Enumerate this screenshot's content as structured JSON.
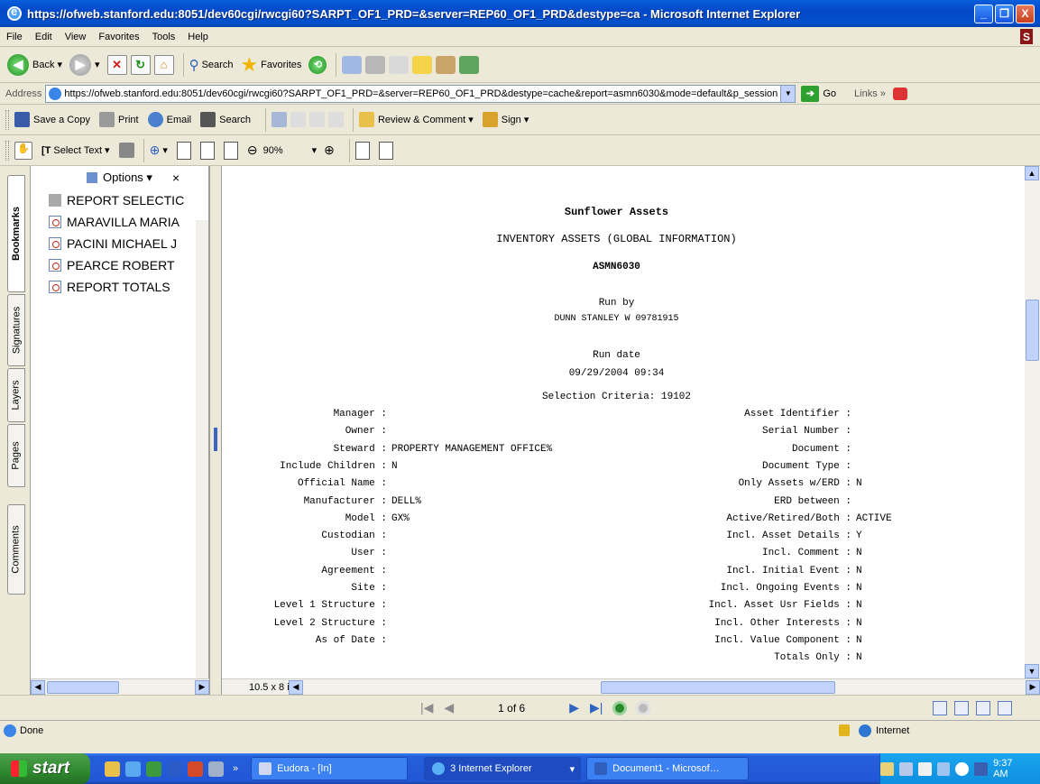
{
  "window": {
    "title": "https://ofweb.stanford.edu:8051/dev60cgi/rwcgi60?SARPT_OF1_PRD=&server=REP60_OF1_PRD&destype=ca - Microsoft Internet Explorer",
    "minimize": "_",
    "maximize": "❐",
    "close": "X"
  },
  "menu": [
    "File",
    "Edit",
    "View",
    "Favorites",
    "Tools",
    "Help"
  ],
  "toolbar": {
    "back": "Back",
    "search": "Search",
    "favorites": "Favorites"
  },
  "address": {
    "label": "Address",
    "url": "https://ofweb.stanford.edu:8051/dev60cgi/rwcgi60?SARPT_OF1_PRD=&server=REP60_OF1_PRD&destype=cache&report=asmn6030&mode=default&p_session",
    "go": "Go",
    "links": "Links »"
  },
  "acrobat": {
    "save_copy": "Save a Copy",
    "print": "Print",
    "email": "Email",
    "search": "Search",
    "review": "Review & Comment",
    "sign": "Sign",
    "select_text": "Select Text",
    "zoom": "90%"
  },
  "side_tabs": [
    "Bookmarks",
    "Signatures",
    "Layers",
    "Pages",
    "Comments"
  ],
  "bookmarks": {
    "options": "Options ▾",
    "close": "×",
    "items": [
      "REPORT SELECTIC",
      "MARAVILLA MARIA",
      "PACINI MICHAEL J",
      "PEARCE ROBERT",
      "REPORT TOTALS"
    ]
  },
  "report": {
    "company": "Sunflower Assets",
    "title": "INVENTORY ASSETS (GLOBAL INFORMATION)",
    "code": "ASMN6030",
    "run_by_label": "Run by",
    "run_by": "DUNN STANLEY W 09781915",
    "run_date_label": "Run date",
    "run_date": "09/29/2004 09:34",
    "selection": "Selection Criteria: 19102",
    "criteria_left": [
      {
        "label": "Manager :",
        "value": ""
      },
      {
        "label": "Owner :",
        "value": ""
      },
      {
        "label": "Steward :",
        "value": "PROPERTY MANAGEMENT OFFICE%"
      },
      {
        "label": "Include Children :",
        "value": "N"
      },
      {
        "label": "Official Name :",
        "value": ""
      },
      {
        "label": "Manufacturer :",
        "value": "DELL%"
      },
      {
        "label": "Model :",
        "value": "GX%"
      },
      {
        "label": "Custodian :",
        "value": ""
      },
      {
        "label": "User :",
        "value": ""
      },
      {
        "label": "Agreement :",
        "value": ""
      },
      {
        "label": "Site :",
        "value": ""
      },
      {
        "label": "Level 1 Structure :",
        "value": ""
      },
      {
        "label": "Level 2 Structure :",
        "value": ""
      },
      {
        "label": "As of Date :",
        "value": ""
      }
    ],
    "criteria_right": [
      {
        "label": "Asset Identifier :",
        "value": ""
      },
      {
        "label": "Serial Number :",
        "value": ""
      },
      {
        "label": "Document :",
        "value": ""
      },
      {
        "label": "Document Type :",
        "value": ""
      },
      {
        "label": "Only Assets w/ERD :",
        "value": "N"
      },
      {
        "label": "ERD between :",
        "value": ""
      },
      {
        "label": "Active/Retired/Both :",
        "value": "ACTIVE"
      },
      {
        "label": "Incl. Asset Details :",
        "value": "Y"
      },
      {
        "label": "Incl. Comment :",
        "value": "N"
      },
      {
        "label": "Incl. Initial Event :",
        "value": "N"
      },
      {
        "label": "Incl. Ongoing Events :",
        "value": "N"
      },
      {
        "label": "Incl. Asset Usr Fields :",
        "value": "N"
      },
      {
        "label": "Incl. Other Interests :",
        "value": "N"
      },
      {
        "label": "Incl. Value Component :",
        "value": "N"
      },
      {
        "label": "Totals Only :",
        "value": "N"
      }
    ]
  },
  "page_size": "10.5 x 8 in",
  "nav": {
    "page": "1 of 6"
  },
  "status": {
    "text": "Done",
    "zone": "Internet"
  },
  "taskbar": {
    "start": "start",
    "tasks": [
      "Eudora - [In]",
      "3 Internet Explorer",
      "Document1 - Microsof…"
    ],
    "clock": "9:37 AM"
  }
}
